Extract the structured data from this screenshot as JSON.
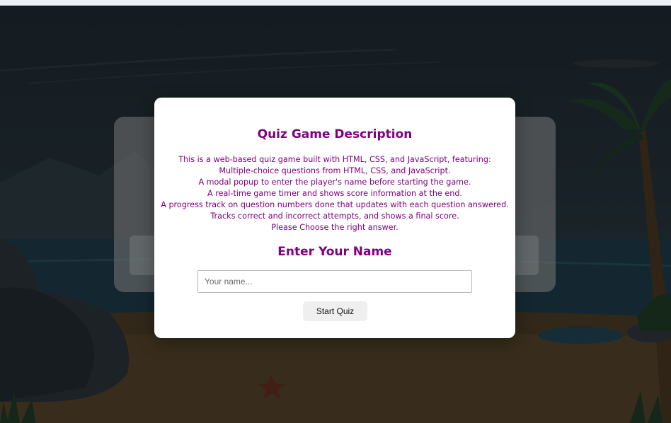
{
  "modal": {
    "description_title": "Quiz Game Description",
    "description_lines": [
      "This is a web-based quiz game built with HTML, CSS, and JavaScript, featuring:",
      "Multiple-choice questions from HTML, CSS, and JavaScript.",
      "A modal popup to enter the player's name before starting the game.",
      "A real-time game timer and shows score information at the end.",
      "A progress track on question numbers done that updates with each question answered.",
      "Tracks correct and incorrect attempts, and shows a final score.",
      "Please Choose the right answer."
    ],
    "name_title": "Enter Your Name",
    "name_input": {
      "placeholder": "Your name...",
      "value": ""
    },
    "start_button_label": "Start Quiz"
  },
  "colors": {
    "heading": "#800080",
    "modal_background": "#ffffff",
    "button_background": "#efefef"
  },
  "icons": {
    "background_scene": "beach-illustration"
  }
}
